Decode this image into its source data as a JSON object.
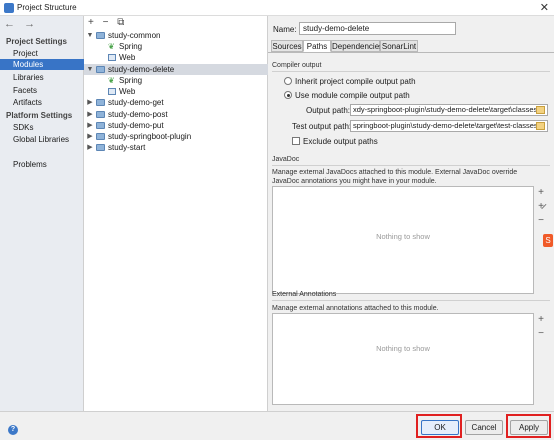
{
  "window": {
    "title": "Project Structure",
    "close": "✕"
  },
  "nav": {
    "back": "←",
    "forward": "→"
  },
  "left_panel": {
    "project_settings_title": "Project Settings",
    "project_items": [
      "Project",
      "Modules",
      "Libraries",
      "Facets",
      "Artifacts"
    ],
    "platform_settings_title": "Platform Settings",
    "platform_items": [
      "SDKs",
      "Global Libraries"
    ],
    "problems": "Problems",
    "selected": "Modules"
  },
  "tree_toolbar": {
    "add": "+",
    "remove": "−",
    "copy": "⧉"
  },
  "tree": [
    {
      "label": "study-common",
      "level": 0,
      "type": "module",
      "expanded": true
    },
    {
      "label": "Spring",
      "level": 1,
      "type": "spring"
    },
    {
      "label": "Web",
      "level": 1,
      "type": "web"
    },
    {
      "label": "study-demo-delete",
      "level": 0,
      "type": "module",
      "expanded": true,
      "selected": true
    },
    {
      "label": "Spring",
      "level": 1,
      "type": "spring"
    },
    {
      "label": "Web",
      "level": 1,
      "type": "web"
    },
    {
      "label": "study-demo-get",
      "level": 0,
      "type": "module",
      "expanded": false
    },
    {
      "label": "study-demo-post",
      "level": 0,
      "type": "module",
      "expanded": false
    },
    {
      "label": "study-demo-put",
      "level": 0,
      "type": "module",
      "expanded": false
    },
    {
      "label": "study-springboot-plugin",
      "level": 0,
      "type": "module",
      "expanded": false
    },
    {
      "label": "study-start",
      "level": 0,
      "type": "module",
      "expanded": false
    }
  ],
  "detail": {
    "name_label": "Name:",
    "name_value": "study-demo-delete",
    "tabs": [
      "Sources",
      "Paths",
      "Dependencies",
      "SonarLint"
    ],
    "active_tab": "Paths",
    "compiler_output_title": "Compiler output",
    "inherit_option": "Inherit project compile output path",
    "use_module_option": "Use module compile output path",
    "output_path_label": "Output path:",
    "output_path_value": "xdy-springboot-plugin\\study-demo-delete\\target\\classes",
    "test_output_path_label": "Test output path:",
    "test_output_path_value": "springboot-plugin\\study-demo-delete\\target\\test-classes",
    "exclude_label": "Exclude output paths",
    "javadoc_title": "JavaDoc",
    "javadoc_desc": "Manage external JavaDocs attached to this module. External JavaDoc override JavaDoc annotations you might have in your module.",
    "javadoc_empty": "Nothing to show",
    "ext_annotations_title": "External Annotations",
    "ext_annotations_desc": "Manage external annotations attached to this module.",
    "ext_annotations_empty": "Nothing to show",
    "side_add": "+",
    "side_add_url": "+̷",
    "side_remove": "−"
  },
  "footer": {
    "help": "?",
    "ok": "OK",
    "cancel": "Cancel",
    "apply": "Apply"
  },
  "side_badge": "S",
  "colors": {
    "selection": "#3874c6",
    "highlight": "#e02020"
  }
}
